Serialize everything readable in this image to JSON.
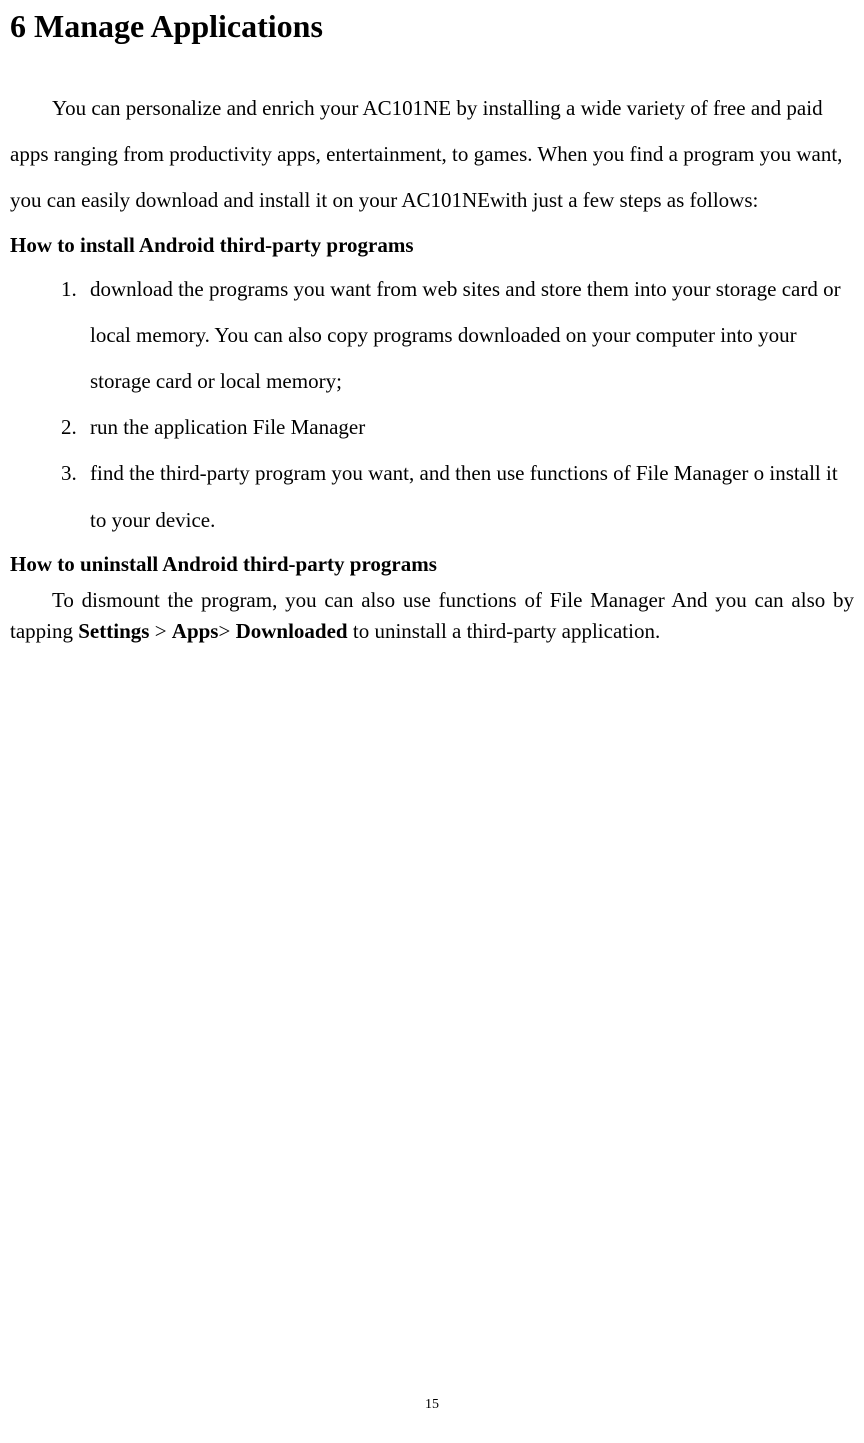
{
  "heading": "6 Manage Applications",
  "intro": "You can personalize and enrich your AC101NE by installing a wide variety of free and paid apps ranging from productivity apps, entertainment, to games. When you find a program you want, you can easily download and install it on your AC101NEwith just a few steps as follows:",
  "installHeading": "How to install Android third-party programs",
  "installSteps": {
    "0": "download the programs you want from web sites and store them into your storage card or local memory. You can also copy programs downloaded on your computer into your storage card or local memory;",
    "1": "run the application File Manager",
    "2": "find the third-party program you want, and then use functions of File Manager o install it to your device."
  },
  "uninstallHeading": "How to uninstall Android third-party programs",
  "uninstall": {
    "prefix": "To dismount the program, you can also use functions of File Manager And you can also by tapping ",
    "b1": "Settings",
    "s1": " > ",
    "b2": "Apps",
    "s2": "> ",
    "b3": "Downloaded",
    "suffix": " to uninstall a third-party application."
  },
  "pageNumber": "15"
}
